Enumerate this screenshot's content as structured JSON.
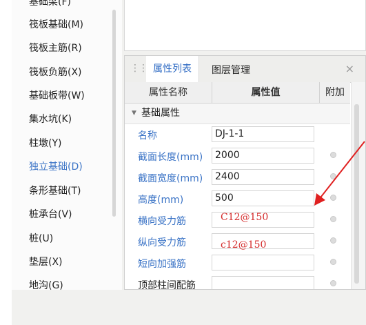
{
  "nav": {
    "items": [
      {
        "label": "基础梁(F)",
        "active": false
      },
      {
        "label": "筏板基础(M)",
        "active": false
      },
      {
        "label": "筏板主筋(R)",
        "active": false
      },
      {
        "label": "筏板负筋(X)",
        "active": false
      },
      {
        "label": "基础板带(W)",
        "active": false
      },
      {
        "label": "集水坑(K)",
        "active": false
      },
      {
        "label": "柱墩(Y)",
        "active": false
      },
      {
        "label": "独立基础(D)",
        "active": true
      },
      {
        "label": "条形基础(T)",
        "active": false
      },
      {
        "label": "桩承台(V)",
        "active": false
      },
      {
        "label": "桩(U)",
        "active": false
      },
      {
        "label": "垫层(X)",
        "active": false
      },
      {
        "label": "地沟(G)",
        "active": false
      }
    ]
  },
  "panel": {
    "tabs": [
      "属性列表",
      "图层管理"
    ],
    "close": "×",
    "columns": [
      "属性名称",
      "属性值",
      "附加"
    ],
    "group": "基础属性",
    "rows": [
      {
        "name": "名称",
        "value": "DJ-1-1"
      },
      {
        "name": "截面长度(mm)",
        "value": "2000"
      },
      {
        "name": "截面宽度(mm)",
        "value": "2400"
      },
      {
        "name": "高度(mm)",
        "value": "500"
      },
      {
        "name": "横向受力筋",
        "value": ""
      },
      {
        "name": "纵向受力筋",
        "value": ""
      },
      {
        "name": "短向加强筋",
        "value": ""
      },
      {
        "name": "顶部柱间配筋",
        "value": ""
      }
    ]
  },
  "annotations": {
    "text1": "C12@150",
    "text2": "c12@150",
    "arrow_color": "#e02020"
  }
}
